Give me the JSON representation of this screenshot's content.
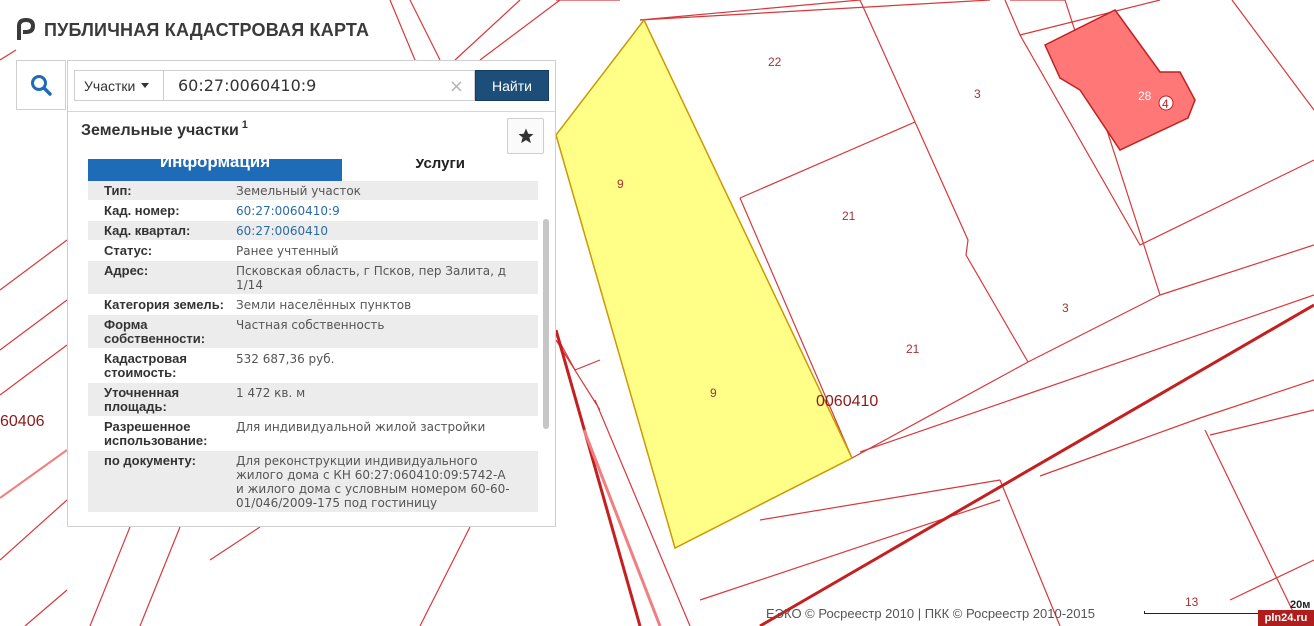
{
  "header": {
    "title": "ПУБЛИЧНАЯ КАДАСТРОВАЯ КАРТА"
  },
  "search": {
    "type_label": "Участки",
    "query": "60:27:0060410:9",
    "clear_symbol": "×",
    "find_label": "Найти",
    "search_icon": "search-icon"
  },
  "result": {
    "title": "Земельные участки",
    "count": "1",
    "favorite_icon": "star-icon",
    "tabs": {
      "info": "Информация",
      "services": "Услуги"
    },
    "fields": [
      {
        "label": "Тип:",
        "value": "Земельный участок"
      },
      {
        "label": "Кад. номер:",
        "value": "60:27:0060410:9"
      },
      {
        "label": "Кад. квартал:",
        "value": "60:27:0060410"
      },
      {
        "label": "Статус:",
        "value": "Ранее учтенный"
      },
      {
        "label": "Адрес:",
        "value": "Псковская область, г Псков, пер Залита, д 1/14"
      },
      {
        "label": "Категория земель:",
        "value": "Земли населённых пунктов"
      },
      {
        "label": "Форма собственности:",
        "value": "Частная собственность"
      },
      {
        "label": "Кадастровая стоимость:",
        "value": "532 687,36 руб."
      },
      {
        "label": "Уточненная площадь:",
        "value": "1 472 кв. м"
      },
      {
        "label": "Разрешенное использование:",
        "value": "Для индивидуальной жилой застройки"
      },
      {
        "label": "по документу:",
        "value": "Для реконструкции индивидуального жилого дома с КН 60:27:060410:09:5742-А и жилого дома с условным номером 60-60-01/046/2009-175 под гостиницу"
      }
    ]
  },
  "map": {
    "labels": {
      "plot_22": "22",
      "plot_3_top": "3",
      "plot_28": "28",
      "plot_4": "4",
      "plot_9_top": "9",
      "plot_21_top": "21",
      "plot_3_bottom": "3",
      "plot_21_bottom": "21",
      "plot_9_bottom": "9",
      "block_0060410": "0060410",
      "block_60406": "60406",
      "plot_13": "13"
    },
    "colors": {
      "selected_fill": "#ffff88",
      "selected_stroke": "#cc9900",
      "building_fill": "#ff7777",
      "parcel_line": "#d42a2a",
      "label": "#a33333"
    },
    "attribution": "ЕЭКО © Росреестр 2010 | ПКК © Росреестр 2010-2015",
    "scale": "20м",
    "watermark": "pln24.ru"
  }
}
